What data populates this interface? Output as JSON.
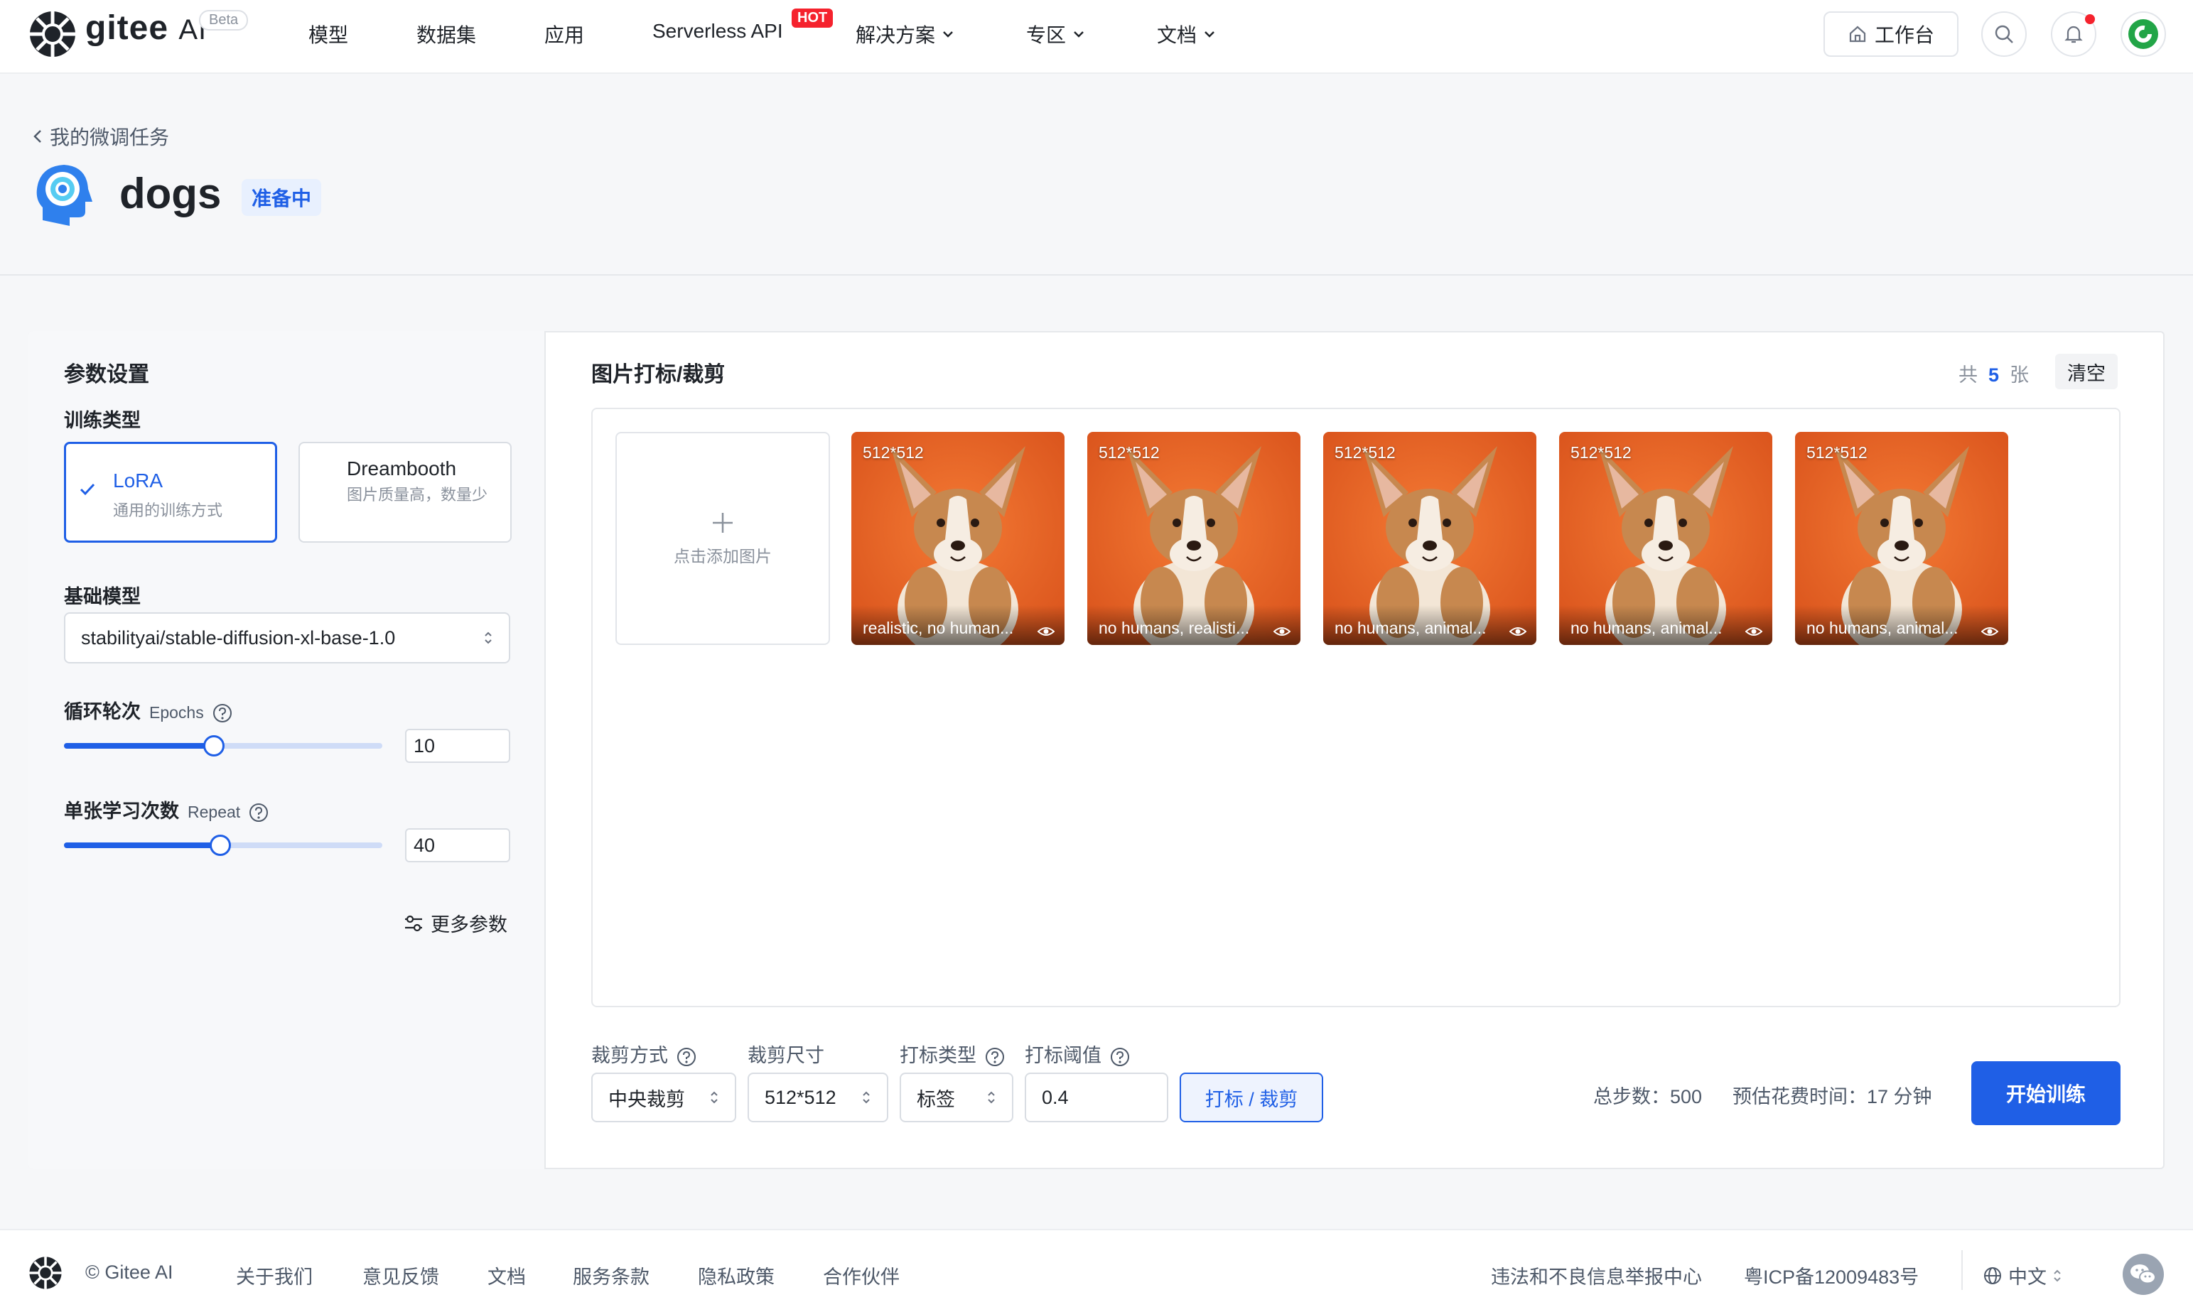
{
  "header": {
    "logo_text": "gitee",
    "logo_ai": "AI",
    "beta": "Beta",
    "nav": [
      "模型",
      "数据集",
      "应用",
      "Serverless API",
      "解决方案",
      "专区",
      "文档"
    ],
    "hot_badge": "HOT",
    "workbench": "工作台",
    "avatar_letter": "G"
  },
  "page": {
    "back_label": "我的微调任务",
    "task_name": "dogs",
    "status": "准备中"
  },
  "params": {
    "title": "参数设置",
    "train_type_label": "训练类型",
    "types": [
      {
        "name": "LoRA",
        "desc": "通用的训练方式",
        "selected": true
      },
      {
        "name": "Dreambooth",
        "desc": "图片质量高，数量少",
        "selected": false
      }
    ],
    "base_model_label": "基础模型",
    "base_model": "stabilityai/stable-diffusion-xl-base-1.0",
    "epochs_label": "循环轮次",
    "epochs_sub": "Epochs",
    "epochs_value": "10",
    "epochs_fraction": 0.47,
    "repeat_label": "单张学习次数",
    "repeat_sub": "Repeat",
    "repeat_value": "40",
    "repeat_fraction": 0.49,
    "more_params": "更多参数"
  },
  "images": {
    "title": "图片打标/裁剪",
    "count_prefix": "共",
    "count": "5",
    "count_suffix": "张",
    "clear": "清空",
    "add_label": "点击添加图片",
    "items": [
      {
        "size": "512*512",
        "caption": "realistic, no human..."
      },
      {
        "size": "512*512",
        "caption": "no humans, realisti..."
      },
      {
        "size": "512*512",
        "caption": "no humans, animal..."
      },
      {
        "size": "512*512",
        "caption": "no humans, animal..."
      },
      {
        "size": "512*512",
        "caption": "no humans, animal..."
      }
    ]
  },
  "controls": {
    "crop_method_label": "裁剪方式",
    "crop_method": "中央裁剪",
    "crop_size_label": "裁剪尺寸",
    "crop_size": "512*512",
    "tag_type_label": "打标类型",
    "tag_type": "标签",
    "threshold_label": "打标阈值",
    "threshold": "0.4",
    "tag_crop_button": "打标 / 裁剪",
    "total_steps": "总步数：500",
    "est_time": "预估花费时间：17 分钟",
    "start_button": "开始训练"
  },
  "footer": {
    "copyright": "© Gitee AI",
    "links": [
      "关于我们",
      "意见反馈",
      "文档",
      "服务条款",
      "隐私政策",
      "合作伙伴"
    ],
    "report": "违法和不良信息举报中心",
    "icp": "粤ICP备12009483号",
    "language": "中文"
  },
  "colors": {
    "accent": "#1f5fe6",
    "hot": "#f5222d",
    "photo_bg": "#f06a2a"
  }
}
